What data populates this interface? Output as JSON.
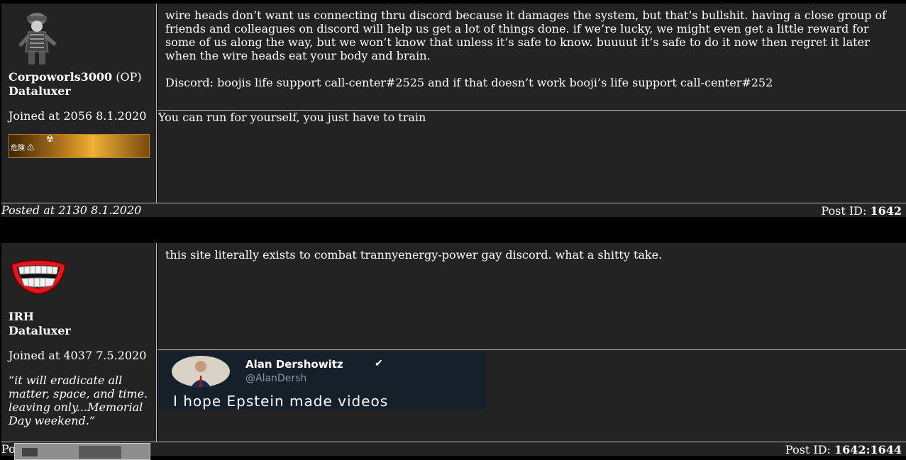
{
  "posts": [
    {
      "username": "Corpoworls3000",
      "op_tag": "(OP)",
      "rank": "Dataluxer",
      "joined": "Joined at 2056 8.1.2020",
      "badge_text": "危険 ⚠",
      "body_p1": "wire heads don’t want us connecting thru discord because it damages the system, but that’s bullshit. having a close group of friends and colleagues on discord will help us get a lot of things done. if we’re lucky, we might even get a little reward for some of us along the way, but we won’t know that unless it’s safe to know. buuuut it’s safe to do it now then regret it later when the wire heads eat your body and brain.",
      "body_p2": "Discord: boojis life support call-center#2525 and if that doesn’t work booji’s life support call-center#252",
      "reply_text": "You can run for yourself, you just have to train",
      "posted": "Posted at 2130 8.1.2020",
      "post_id_label": "Post ID:",
      "post_id": "1642"
    },
    {
      "username": "IRH",
      "rank": "Dataluxer",
      "joined": "Joined at 4037 7.5.2020",
      "quote": "“it will eradicate all matter, space, and time. leaving only...Memorial Day weekend.”",
      "body": "this site literally exists to combat trannyenergy-power gay discord. what a shitty take.",
      "tweet_name": "Alan Dershowitz",
      "tweet_handle": "@AlanDersh",
      "tweet_text": "I hope Epstein made videos",
      "posted_partial": "Po",
      "post_id_label": "Post ID:",
      "post_id": "1642:1644"
    }
  ]
}
